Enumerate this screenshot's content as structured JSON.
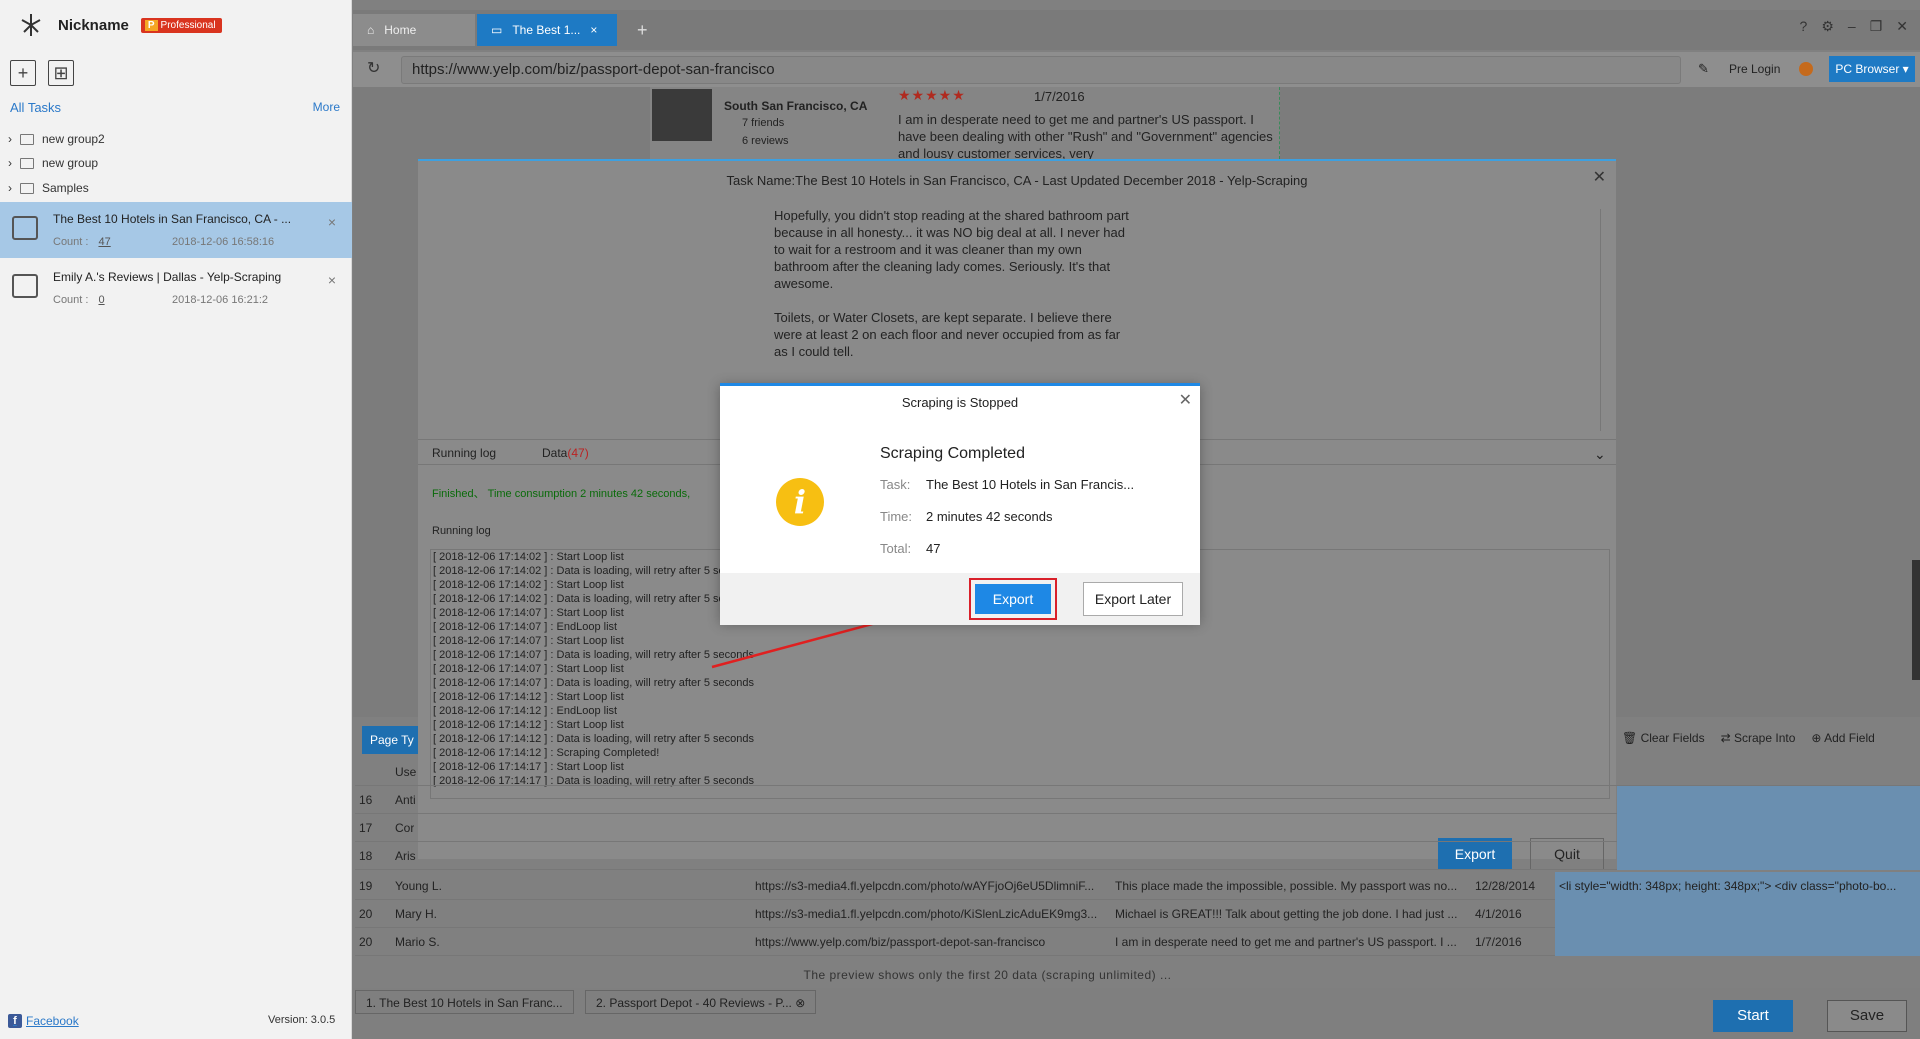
{
  "sidebar": {
    "nickname": "Nickname",
    "badge_p": "P",
    "badge_label": "Professional",
    "all_tasks": "All Tasks",
    "more": "More",
    "groups": [
      "new group2",
      "new group",
      "Samples"
    ],
    "tasks": [
      {
        "title": "The Best 10 Hotels in San Francisco, CA - ...",
        "count_label": "Count :",
        "count": "47",
        "date": "2018-12-06 16:58:16"
      },
      {
        "title": "Emily A.'s Reviews | Dallas - Yelp-Scraping",
        "count_label": "Count :",
        "count": "0",
        "date": "2018-12-06 16:21:2"
      }
    ],
    "facebook": "Facebook",
    "version": "Version: 3.0.5"
  },
  "tabs": {
    "home": "Home",
    "active": "The Best 1..."
  },
  "url": "https://www.yelp.com/biz/passport-depot-san-francisco",
  "browser": {
    "pre_login": "Pre Login",
    "pc_browser": "PC Browser"
  },
  "review_preview": {
    "location": "South San Francisco, CA",
    "friends": "7 friends",
    "reviews": "6 reviews",
    "date": "1/7/2016",
    "text": "I am in desperate need to get me and partner's US passport. I have been dealing with other \"Rush\" and \"Government\" agencies and lousy customer services, very"
  },
  "panel": {
    "title": "Task Name:The Best 10 Hotels in San Francisco, CA - Last Updated December 2018 - Yelp-Scraping",
    "preview_paragraphs": [
      "Hopefully, you didn't stop reading at the shared bathroom part because in all honesty... it was NO big deal at all. I never had to wait for a restroom and it was cleaner than my own bathroom after the cleaning lady comes. Seriously. It's that awesome.",
      "Toilets, or Water Closets, are kept separate. I believe there were at least 2 on each floor and never occupied from as far as I could tell."
    ],
    "tab_running": "Running log",
    "tab_data": "Data",
    "tab_data_count": "(47)",
    "finished": "Finished、 Time consumption 2 minutes 42 seconds,",
    "running_log_label": "Running log",
    "log_lines": [
      "[ 2018-12-06 17:14:02 ] : Start Loop list",
      "[ 2018-12-06 17:14:02 ] : Data is loading, will retry after 5 seconds",
      "[ 2018-12-06 17:14:02 ] : Start Loop list",
      "[ 2018-12-06 17:14:02 ] : Data is loading, will retry after 5 seconds",
      "[ 2018-12-06 17:14:07 ] : Start Loop list",
      "[ 2018-12-06 17:14:07 ] : EndLoop list",
      "[ 2018-12-06 17:14:07 ] : Start Loop list",
      "[ 2018-12-06 17:14:07 ] : Data is loading, will retry after 5 seconds",
      "[ 2018-12-06 17:14:07 ] : Start Loop list",
      "[ 2018-12-06 17:14:07 ] : Data is loading, will retry after 5 seconds",
      "[ 2018-12-06 17:14:12 ] : Start Loop list",
      "[ 2018-12-06 17:14:12 ] : EndLoop list",
      "[ 2018-12-06 17:14:12 ] : Start Loop list",
      "[ 2018-12-06 17:14:12 ] : Data is loading, will retry after 5 seconds",
      "[ 2018-12-06 17:14:12 ] : Scraping Completed!",
      "[ 2018-12-06 17:14:17 ] : Start Loop list",
      "[ 2018-12-06 17:14:17 ] : Data is loading, will retry after 5 seconds"
    ],
    "export": "Export",
    "quit": "Quit"
  },
  "toolbar": {
    "clear_fields": "Clear Fields",
    "scrape_into": "Scrape Into",
    "add_field": "Add Field",
    "page_type": "Page Ty"
  },
  "table": {
    "header": "Use",
    "partial_rows": [
      {
        "num": "16",
        "user": "Anti"
      },
      {
        "num": "17",
        "user": "Cor"
      },
      {
        "num": "18",
        "user": "Aris"
      }
    ],
    "rows": [
      {
        "num": "19",
        "user": "Young L.",
        "photo": "https://s3-media4.fl.yelpcdn.com/photo/wAYFjoOj6eU5DlimniF...",
        "review": "This place made the impossible, possible. My passport was no...",
        "date": "12/28/2014",
        "html": "<li style=\"width: 348px; height: 348px;\"> <div class=\"photo-bo..."
      },
      {
        "num": "20",
        "user": "Mary H.",
        "photo": "https://s3-media1.fl.yelpcdn.com/photo/KiSlenLzicAduEK9mg3...",
        "review": "Michael is GREAT!!! Talk about getting the job done. I had just ...",
        "date": "4/1/2016",
        "html": ""
      },
      {
        "num": "20",
        "user": "Mario S.",
        "photo": "https://www.yelp.com/biz/passport-depot-san-francisco",
        "review": "I am in desperate need to get me and partner's US passport. I ...",
        "date": "1/7/2016",
        "html": ""
      }
    ],
    "note": "The preview shows only the first 20 data (scraping unlimited) ..."
  },
  "bottom": {
    "tab1": "1. The Best 10 Hotels in San Franc...",
    "tab2": "2. Passport Depot - 40 Reviews - P...",
    "start": "Start",
    "save": "Save"
  },
  "dialog": {
    "title": "Scraping is Stopped",
    "heading": "Scraping Completed",
    "task_label": "Task:",
    "task_value": "The Best 10 Hotels in San Francis...",
    "time_label": "Time:",
    "time_value": "2 minutes 42 seconds",
    "total_label": "Total:",
    "total_value": "47",
    "export": "Export",
    "export_later": "Export Later",
    "icon_glyph": "i"
  },
  "colors": {
    "accent": "#1e88e5",
    "highlight": "#d9202a",
    "warning": "#f7bf12"
  }
}
